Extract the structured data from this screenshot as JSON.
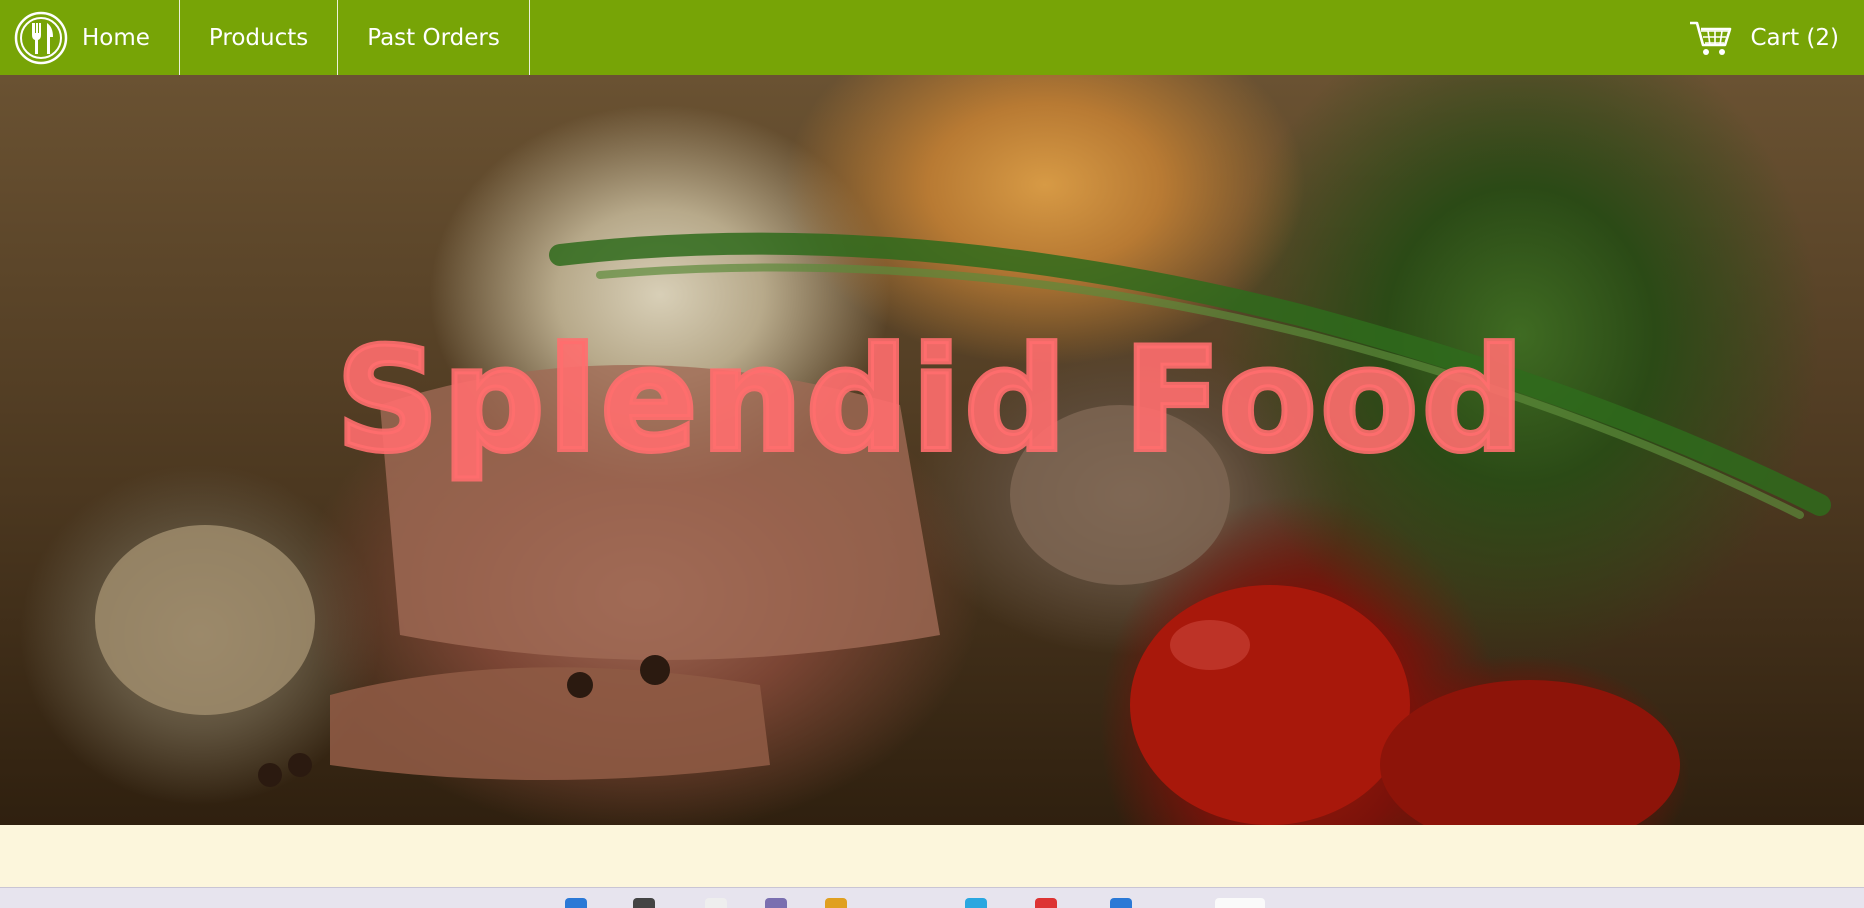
{
  "nav": {
    "home_label": "Home",
    "products_label": "Products",
    "orders_label": "Past Orders",
    "cart_label": "Cart (2)",
    "logo_icon": "fork-knife-plate-icon",
    "cart_icon": "shopping-cart-icon",
    "bar_color": "#77a406"
  },
  "hero": {
    "title": "Splendid Food",
    "title_color": "#ff6e6e"
  },
  "page": {
    "background": "#fcf6dc"
  }
}
